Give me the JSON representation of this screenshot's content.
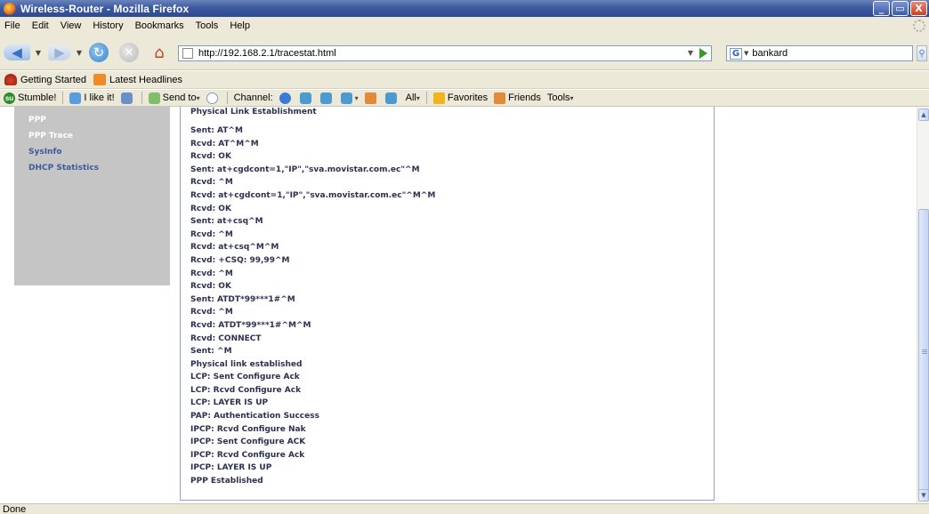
{
  "window": {
    "title": "Wireless-Router - Mozilla Firefox",
    "buttons": [
      "_",
      "▭",
      "X"
    ]
  },
  "menu": [
    "File",
    "Edit",
    "View",
    "History",
    "Bookmarks",
    "Tools",
    "Help"
  ],
  "navigation": {
    "url": "http://192.168.2.1/tracestat.html",
    "search_engine_icon": "G",
    "search_value": "bankard"
  },
  "bookmarks": [
    "Getting Started",
    "Latest Headlines"
  ],
  "stumble_toolbar": {
    "stumble": "Stumble!",
    "like": "I like it!",
    "send_to": "Send to",
    "channel": "Channel:",
    "all": "All",
    "favorites": "Favorites",
    "friends": "Friends",
    "tools": "Tools"
  },
  "sidebar": [
    {
      "label": "PPP",
      "style": "white"
    },
    {
      "label": "PPP Trace",
      "style": "white"
    },
    {
      "label": "SysInfo",
      "style": "blue"
    },
    {
      "label": "DHCP Statistics",
      "style": "blue"
    }
  ],
  "trace": {
    "title": "Physical Link Establishment",
    "lines": [
      "Sent: AT^M",
      "Rcvd: AT^M^M",
      "Rcvd: OK",
      "Sent: at+cgdcont=1,\"IP\",\"sva.movistar.com.ec\"^M",
      "Rcvd: ^M",
      "Rcvd: at+cgdcont=1,\"IP\",\"sva.movistar.com.ec\"^M^M",
      "Rcvd: OK",
      "Sent: at+csq^M",
      "Rcvd: ^M",
      "Rcvd: at+csq^M^M",
      "Rcvd: +CSQ: 99,99^M",
      "Rcvd: ^M",
      "Rcvd: OK",
      "Sent: ATDT*99***1#^M",
      "Rcvd: ^M",
      "Rcvd: ATDT*99***1#^M^M",
      "Rcvd: CONNECT",
      "Sent: ^M",
      "Physical link established",
      "LCP: Sent Configure Ack",
      "LCP: Rcvd Configure Ack",
      "LCP: LAYER IS UP",
      "PAP: Authentication Success",
      "IPCP: Rcvd Configure Nak",
      "IPCP: Sent Configure ACK",
      "IPCP: Rcvd Configure Ack",
      "IPCP: LAYER IS UP",
      "PPP Established"
    ]
  },
  "status": "Done",
  "icons": [
    "firefox-icon",
    "back-arrow-icon",
    "forward-arrow-icon",
    "reload-icon",
    "stop-icon",
    "home-icon",
    "page-icon",
    "go-icon",
    "google-icon",
    "search-icon",
    "rss-icon",
    "stumbleupon-icon"
  ]
}
